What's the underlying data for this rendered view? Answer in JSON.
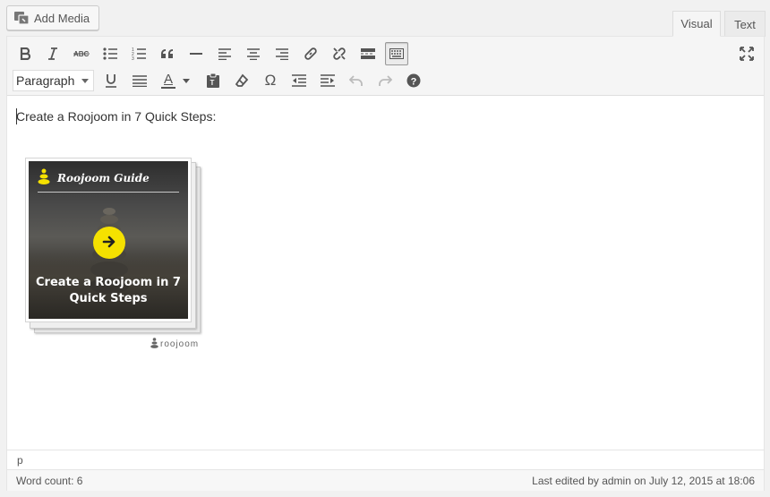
{
  "add_media": {
    "label": "Add Media",
    "icon": "media-icon"
  },
  "tabs": [
    {
      "label": "Visual",
      "active": true
    },
    {
      "label": "Text",
      "active": false
    }
  ],
  "toolbar": {
    "row1": [
      "bold-icon",
      "italic-icon",
      "strikethrough-icon",
      "bullet-list-icon",
      "numbered-list-icon",
      "blockquote-icon",
      "horizontal-rule-icon",
      "align-left-icon",
      "align-center-icon",
      "align-right-icon",
      "link-icon",
      "unlink-icon",
      "read-more-icon",
      "toolbar-toggle-icon"
    ],
    "row2": [
      "underline-icon",
      "justify-icon",
      "text-color-icon",
      "paste-text-icon",
      "clear-formatting-icon",
      "special-character-icon",
      "outdent-icon",
      "indent-icon",
      "undo-icon",
      "redo-icon",
      "help-icon"
    ],
    "fullscreen_icon": "fullscreen-icon",
    "format_select": "Paragraph",
    "omega": "Ω",
    "text_color_letter": "A"
  },
  "content": {
    "text": "Create a Roojoom in 7 Quick Steps:",
    "embed": {
      "header": "Roojoom Guide",
      "caption_line1": "Create a Roojoom in 7",
      "caption_line2": "Quick Steps",
      "brand": "roojoom",
      "accent_color": "#f5e100"
    }
  },
  "path": "p",
  "status": {
    "word_count": "Word count: 6",
    "last_edited": "Last edited by admin on July 12, 2015 at 18:06"
  }
}
